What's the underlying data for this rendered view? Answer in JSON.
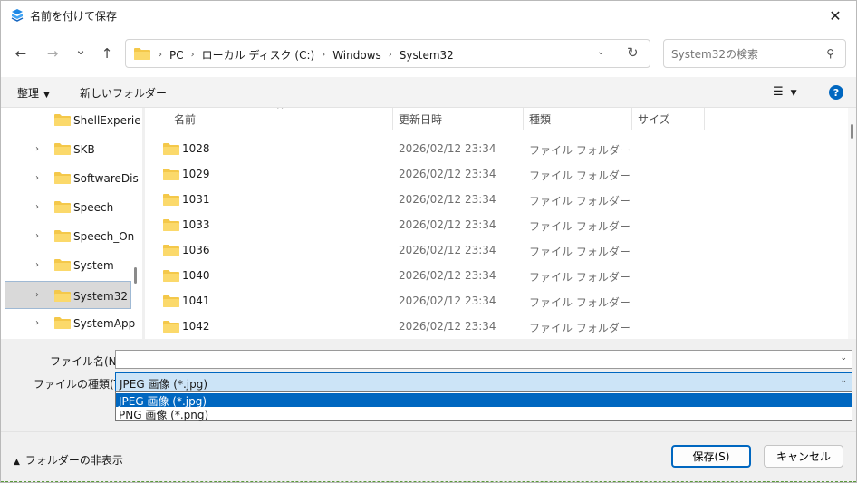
{
  "window": {
    "title": "名前を付けて保存",
    "close_glyph": "✕"
  },
  "nav": {
    "back": "←",
    "forward": "→",
    "recent": "⌄",
    "up": "↑",
    "breadcrumbs": [
      "PC",
      "ローカル ディスク (C:)",
      "Windows",
      "System32"
    ],
    "crumb_sep": "›",
    "dropdown": "⌄",
    "refresh": "↻",
    "search_placeholder": "System32の検索",
    "search_icon": "⚲"
  },
  "toolbar": {
    "organize_label": "整理",
    "organize_caret": "▼",
    "new_folder_label": "新しいフォルダー",
    "view_icon": "☰",
    "view_caret": "▼",
    "help_icon": "?"
  },
  "tree": {
    "items": [
      {
        "label": "ShellExperie",
        "chev": ""
      },
      {
        "label": "SKB",
        "chev": "›"
      },
      {
        "label": "SoftwareDis",
        "chev": "›"
      },
      {
        "label": "Speech",
        "chev": "›"
      },
      {
        "label": "Speech_On",
        "chev": "›"
      },
      {
        "label": "System",
        "chev": "›"
      },
      {
        "label": "System32",
        "chev": "›"
      },
      {
        "label": "SystemApp",
        "chev": "›"
      }
    ]
  },
  "files": {
    "columns": {
      "name": "名前",
      "date": "更新日時",
      "type": "種類",
      "size": "サイズ"
    },
    "sort_caret": "^",
    "rows": [
      {
        "name": "1028",
        "date": "2026/02/12 23:34",
        "type": "ファイル フォルダー"
      },
      {
        "name": "1029",
        "date": "2026/02/12 23:34",
        "type": "ファイル フォルダー"
      },
      {
        "name": "1031",
        "date": "2026/02/12 23:34",
        "type": "ファイル フォルダー"
      },
      {
        "name": "1033",
        "date": "2026/02/12 23:34",
        "type": "ファイル フォルダー"
      },
      {
        "name": "1036",
        "date": "2026/02/12 23:34",
        "type": "ファイル フォルダー"
      },
      {
        "name": "1040",
        "date": "2026/02/12 23:34",
        "type": "ファイル フォルダー"
      },
      {
        "name": "1041",
        "date": "2026/02/12 23:34",
        "type": "ファイル フォルダー"
      },
      {
        "name": "1042",
        "date": "2026/02/12 23:34",
        "type": "ファイル フォルダー"
      }
    ]
  },
  "form": {
    "filename_label": "ファイル名(N):",
    "filename_value": "",
    "filetype_label": "ファイルの種類(T):",
    "filetype_value": "JPEG 画像 (*.jpg)",
    "filetype_options": [
      "JPEG 画像 (*.jpg)",
      "PNG 画像 (*.png)"
    ],
    "caret": "⌄"
  },
  "footer": {
    "hide_folders_label": "フォルダーの非表示",
    "hide_caret": "▲",
    "save_label": "保存(S)",
    "cancel_label": "キャンセル"
  },
  "colors": {
    "accent": "#0067c0",
    "folder": "#f4c84a",
    "selection": "#cce4f7"
  }
}
